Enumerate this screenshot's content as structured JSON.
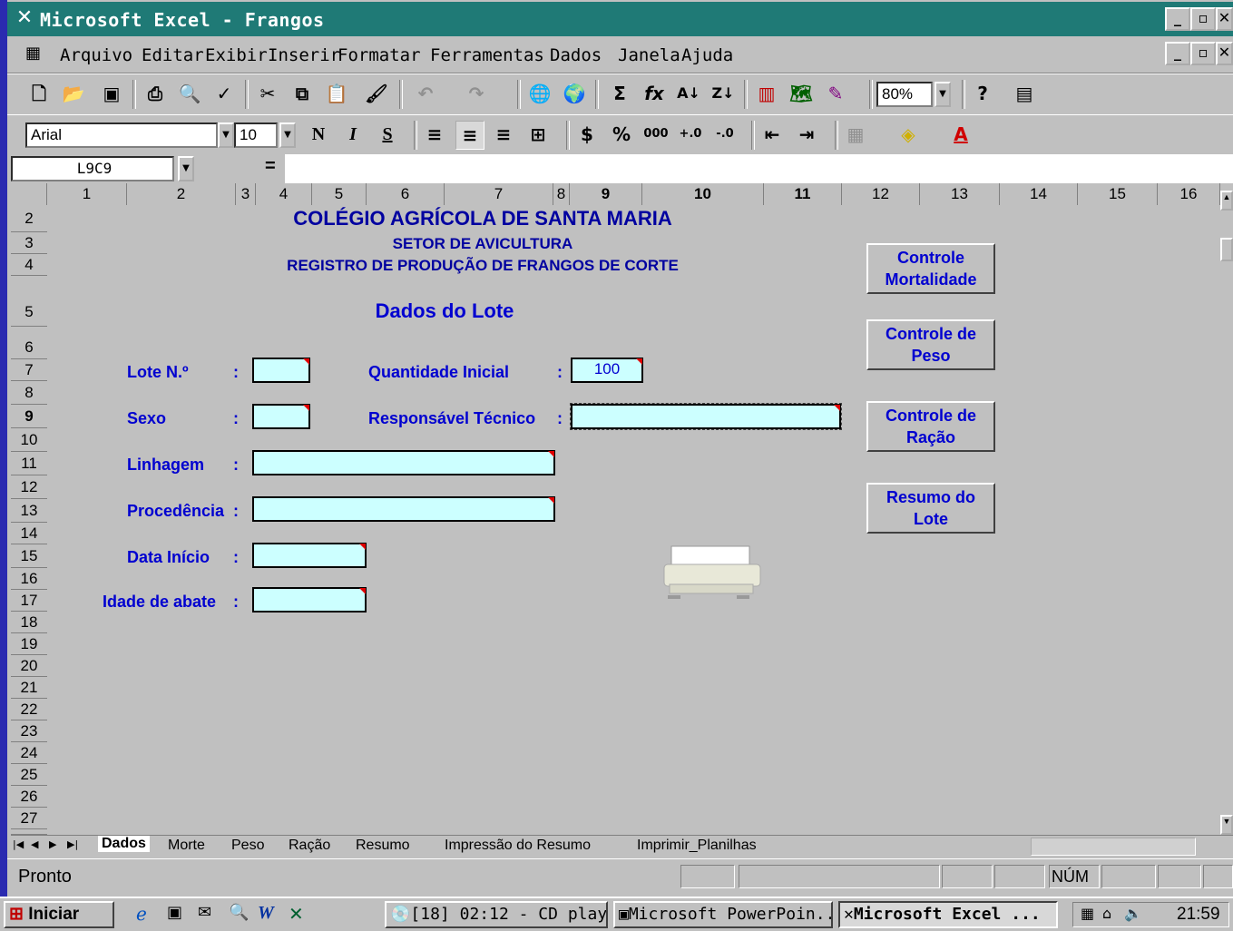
{
  "window": {
    "title": "Microsoft Excel - Frangos"
  },
  "menu": [
    "Arquivo",
    "Editar",
    "Exibir",
    "Inserir",
    "Formatar",
    "Ferramentas",
    "Dados",
    "Janela",
    "Ajuda"
  ],
  "toolbar": {
    "zoom": "80%"
  },
  "format_toolbar": {
    "font": "Arial",
    "size": "10",
    "bold": "N",
    "italic": "I",
    "underline": "S"
  },
  "formula_bar": {
    "name_box": "L9C9",
    "equals": "="
  },
  "columns": [
    "1",
    "2",
    "3",
    "4",
    "5",
    "6",
    "7",
    "8",
    "9",
    "10",
    "11",
    "12",
    "13",
    "14",
    "15",
    "16"
  ],
  "rows": [
    "2",
    "3",
    "4",
    "5",
    "6",
    "7",
    "8",
    "9",
    "10",
    "11",
    "12",
    "13",
    "14",
    "15",
    "16",
    "17",
    "18",
    "19",
    "20",
    "21",
    "22",
    "23",
    "24",
    "25",
    "26",
    "27"
  ],
  "sheet": {
    "heading1": "COLÉGIO AGRÍCOLA DE SANTA MARIA",
    "heading2": "SETOR DE AVICULTURA",
    "heading3": "REGISTRO DE PRODUÇÃO DE FRANGOS DE CORTE",
    "section_title": "Dados do Lote",
    "labels": {
      "lote": "Lote N.º",
      "sexo": "Sexo",
      "linhagem": "Linhagem",
      "procedencia": "Procedência",
      "data_inicio": "Data Início",
      "idade_abate": "Idade de abate",
      "quantidade_inicial": "Quantidade Inicial",
      "responsavel_tecnico": "Responsável Técnico"
    },
    "colon": ":",
    "values": {
      "quantidade_inicial": "100"
    },
    "buttons": {
      "mortalidade": [
        "Controle",
        "Mortalidade"
      ],
      "peso": [
        "Controle de",
        "Peso"
      ],
      "racao": [
        "Controle de",
        "Ração"
      ],
      "resumo": [
        "Resumo do",
        "Lote"
      ]
    }
  },
  "tabs": [
    "Dados",
    "Morte",
    "Peso",
    "Ração",
    "Resumo",
    "Impressão do Resumo",
    "Imprimir_Planilhas"
  ],
  "status": {
    "text": "Pronto",
    "num": "NÚM"
  },
  "taskbar": {
    "start": "Iniciar",
    "tasks": [
      "[18] 02:12 - CD play...",
      "Microsoft PowerPoin...",
      "Microsoft Excel ..."
    ],
    "clock": "21:59"
  }
}
